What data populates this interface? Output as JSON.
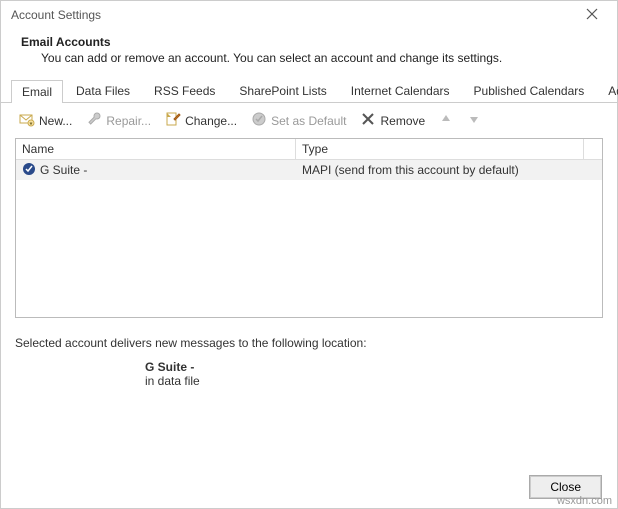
{
  "window": {
    "title": "Account Settings"
  },
  "header": {
    "title": "Email Accounts",
    "subtitle": "You can add or remove an account. You can select an account and change its settings."
  },
  "tabs": [
    {
      "label": "Email",
      "active": true
    },
    {
      "label": "Data Files"
    },
    {
      "label": "RSS Feeds"
    },
    {
      "label": "SharePoint Lists"
    },
    {
      "label": "Internet Calendars"
    },
    {
      "label": "Published Calendars"
    },
    {
      "label": "Address Books"
    }
  ],
  "toolbar": {
    "new": "New...",
    "repair": "Repair...",
    "change": "Change...",
    "set_default": "Set as Default",
    "remove": "Remove"
  },
  "list": {
    "columns": {
      "name": "Name",
      "type": "Type"
    },
    "rows": [
      {
        "name": "G Suite -",
        "type": "MAPI (send from this account by default)"
      }
    ]
  },
  "delivery": {
    "caption": "Selected account delivers new messages to the following location:",
    "account": "G Suite -",
    "location": "in data file"
  },
  "footer": {
    "close": "Close"
  },
  "watermark": "wsxdn.com"
}
